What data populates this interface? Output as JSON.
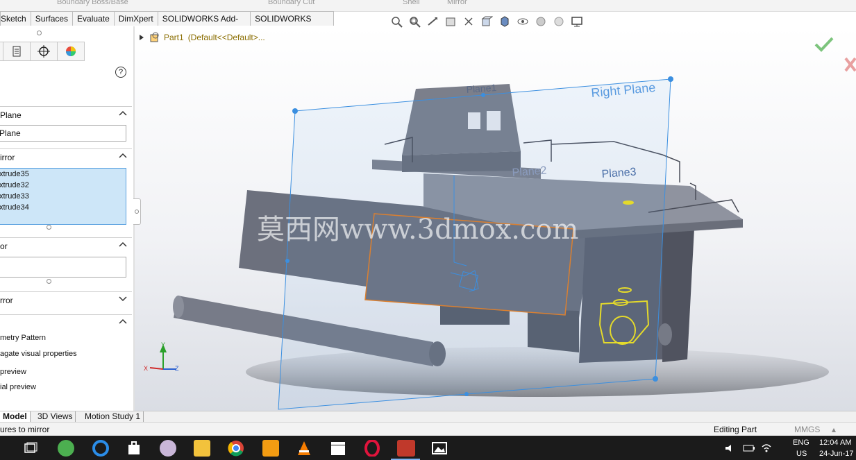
{
  "top_strip": {
    "boundary_boss": "Boundary Boss/Base",
    "boundary_cut": "Boundary Cut",
    "shell": "Shell",
    "mirror": "Mirror"
  },
  "command_tabs": [
    "Sketch",
    "Surfaces",
    "Evaluate",
    "DimXpert",
    "SOLIDWORKS Add-Ins",
    "SOLIDWORKS MBD"
  ],
  "feature_tree": {
    "part": "Part1",
    "config": "(Default<<Default>..."
  },
  "panel": {
    "help": "?",
    "sections": {
      "plane": {
        "title": "Plane",
        "value": "Plane"
      },
      "mirror_faces": {
        "title": "irror",
        "items": [
          "xtrude35",
          "xtrude32",
          "xtrude33",
          "xtrude34"
        ]
      },
      "bodies": {
        "title": "or",
        "value": ""
      },
      "mirror_bodies": {
        "title": "rror"
      },
      "options": {
        "geometry_pattern": "metry Pattern",
        "propagate": "agate visual properties",
        "full_preview": "preview",
        "partial_preview": "ial preview"
      }
    }
  },
  "viewport": {
    "right_plane": "Right Plane",
    "plane2": "Plane2",
    "plane3": "Plane3",
    "plane1": "Plane1",
    "watermark": "莫西网www.3dmox.com",
    "triad": {
      "x": "X",
      "y": "Y",
      "z": "Z"
    }
  },
  "bottom_tabs": [
    "Model",
    "3D Views",
    "Motion Study 1"
  ],
  "status": {
    "left": "ures to mirror",
    "editing": "Editing Part",
    "units": "MMGS"
  },
  "tray": {
    "lang1": "ENG",
    "lang2": "US",
    "time": "12:04 AM",
    "date": "24-Jun-17"
  },
  "colors": {
    "accent": "#5aa1e0",
    "ok_green": "#7cc47c",
    "cancel_red": "#e8a0a0",
    "selection_orange": "#e67e22",
    "selection_yellow": "#f1e01c"
  }
}
